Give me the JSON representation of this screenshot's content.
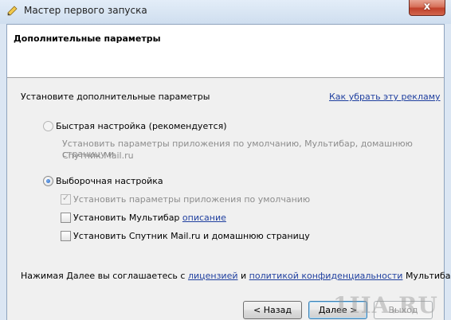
{
  "window": {
    "title": "Мастер первого запуска",
    "close_label": "x"
  },
  "header": {
    "title": "Дополнительные параметры"
  },
  "intro": {
    "text": "Установите дополнительные параметры",
    "ad_link": "Как убрать эту рекламу"
  },
  "options": {
    "quick": {
      "label": "Быстрая настройка (рекомендуется)",
      "selected": false,
      "description_line1": "Установить параметры приложения по умолчанию, Мультибар, домашнюю страницу и",
      "description_line2": "Спутник Mail.ru"
    },
    "custom": {
      "label": "Выборочная настройка",
      "selected": true
    }
  },
  "checkboxes": {
    "defaults": {
      "label": "Установить параметры приложения по умолчанию",
      "checked": true,
      "disabled": true
    },
    "multibar": {
      "label": "Установить Мультибар",
      "link": "описание",
      "checked": false
    },
    "sputnik": {
      "label": "Установить Спутник Mail.ru и домашнюю страницу",
      "checked": false
    }
  },
  "agreement": {
    "prefix": "Нажимая Далее вы соглашаетесь с",
    "license_link": "лицензией",
    "and": "и",
    "privacy_link": "политикой конфиденциальности",
    "suffix": "Мультибар"
  },
  "buttons": {
    "back": "< Назад",
    "next": "Далее >",
    "exit": "Выход"
  },
  "watermark": "1IIA.RU",
  "colors": {
    "link": "#1f3f9f",
    "client_bg": "#f0f0f0",
    "frame": "#dbe6f3"
  }
}
